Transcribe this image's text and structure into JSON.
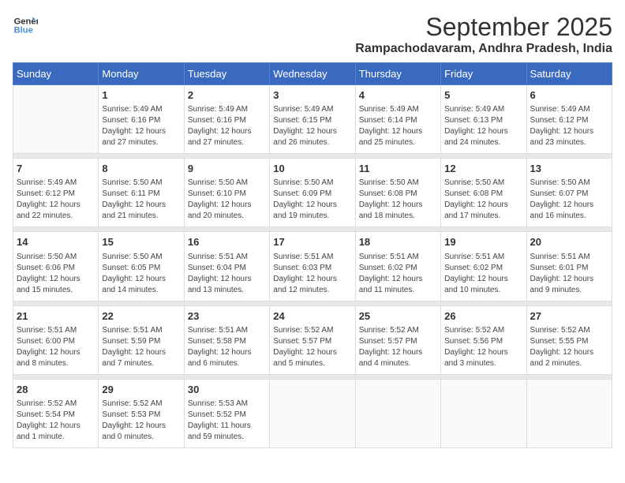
{
  "logo": {
    "line1": "General",
    "line2": "Blue"
  },
  "title": "September 2025",
  "location": "Rampachodavaram, Andhra Pradesh, India",
  "days_of_week": [
    "Sunday",
    "Monday",
    "Tuesday",
    "Wednesday",
    "Thursday",
    "Friday",
    "Saturday"
  ],
  "weeks": [
    [
      {
        "day": "",
        "info": ""
      },
      {
        "day": "1",
        "info": "Sunrise: 5:49 AM\nSunset: 6:16 PM\nDaylight: 12 hours\nand 27 minutes."
      },
      {
        "day": "2",
        "info": "Sunrise: 5:49 AM\nSunset: 6:16 PM\nDaylight: 12 hours\nand 27 minutes."
      },
      {
        "day": "3",
        "info": "Sunrise: 5:49 AM\nSunset: 6:15 PM\nDaylight: 12 hours\nand 26 minutes."
      },
      {
        "day": "4",
        "info": "Sunrise: 5:49 AM\nSunset: 6:14 PM\nDaylight: 12 hours\nand 25 minutes."
      },
      {
        "day": "5",
        "info": "Sunrise: 5:49 AM\nSunset: 6:13 PM\nDaylight: 12 hours\nand 24 minutes."
      },
      {
        "day": "6",
        "info": "Sunrise: 5:49 AM\nSunset: 6:12 PM\nDaylight: 12 hours\nand 23 minutes."
      }
    ],
    [
      {
        "day": "7",
        "info": "Sunrise: 5:49 AM\nSunset: 6:12 PM\nDaylight: 12 hours\nand 22 minutes."
      },
      {
        "day": "8",
        "info": "Sunrise: 5:50 AM\nSunset: 6:11 PM\nDaylight: 12 hours\nand 21 minutes."
      },
      {
        "day": "9",
        "info": "Sunrise: 5:50 AM\nSunset: 6:10 PM\nDaylight: 12 hours\nand 20 minutes."
      },
      {
        "day": "10",
        "info": "Sunrise: 5:50 AM\nSunset: 6:09 PM\nDaylight: 12 hours\nand 19 minutes."
      },
      {
        "day": "11",
        "info": "Sunrise: 5:50 AM\nSunset: 6:08 PM\nDaylight: 12 hours\nand 18 minutes."
      },
      {
        "day": "12",
        "info": "Sunrise: 5:50 AM\nSunset: 6:08 PM\nDaylight: 12 hours\nand 17 minutes."
      },
      {
        "day": "13",
        "info": "Sunrise: 5:50 AM\nSunset: 6:07 PM\nDaylight: 12 hours\nand 16 minutes."
      }
    ],
    [
      {
        "day": "14",
        "info": "Sunrise: 5:50 AM\nSunset: 6:06 PM\nDaylight: 12 hours\nand 15 minutes."
      },
      {
        "day": "15",
        "info": "Sunrise: 5:50 AM\nSunset: 6:05 PM\nDaylight: 12 hours\nand 14 minutes."
      },
      {
        "day": "16",
        "info": "Sunrise: 5:51 AM\nSunset: 6:04 PM\nDaylight: 12 hours\nand 13 minutes."
      },
      {
        "day": "17",
        "info": "Sunrise: 5:51 AM\nSunset: 6:03 PM\nDaylight: 12 hours\nand 12 minutes."
      },
      {
        "day": "18",
        "info": "Sunrise: 5:51 AM\nSunset: 6:02 PM\nDaylight: 12 hours\nand 11 minutes."
      },
      {
        "day": "19",
        "info": "Sunrise: 5:51 AM\nSunset: 6:02 PM\nDaylight: 12 hours\nand 10 minutes."
      },
      {
        "day": "20",
        "info": "Sunrise: 5:51 AM\nSunset: 6:01 PM\nDaylight: 12 hours\nand 9 minutes."
      }
    ],
    [
      {
        "day": "21",
        "info": "Sunrise: 5:51 AM\nSunset: 6:00 PM\nDaylight: 12 hours\nand 8 minutes."
      },
      {
        "day": "22",
        "info": "Sunrise: 5:51 AM\nSunset: 5:59 PM\nDaylight: 12 hours\nand 7 minutes."
      },
      {
        "day": "23",
        "info": "Sunrise: 5:51 AM\nSunset: 5:58 PM\nDaylight: 12 hours\nand 6 minutes."
      },
      {
        "day": "24",
        "info": "Sunrise: 5:52 AM\nSunset: 5:57 PM\nDaylight: 12 hours\nand 5 minutes."
      },
      {
        "day": "25",
        "info": "Sunrise: 5:52 AM\nSunset: 5:57 PM\nDaylight: 12 hours\nand 4 minutes."
      },
      {
        "day": "26",
        "info": "Sunrise: 5:52 AM\nSunset: 5:56 PM\nDaylight: 12 hours\nand 3 minutes."
      },
      {
        "day": "27",
        "info": "Sunrise: 5:52 AM\nSunset: 5:55 PM\nDaylight: 12 hours\nand 2 minutes."
      }
    ],
    [
      {
        "day": "28",
        "info": "Sunrise: 5:52 AM\nSunset: 5:54 PM\nDaylight: 12 hours\nand 1 minute."
      },
      {
        "day": "29",
        "info": "Sunrise: 5:52 AM\nSunset: 5:53 PM\nDaylight: 12 hours\nand 0 minutes."
      },
      {
        "day": "30",
        "info": "Sunrise: 5:53 AM\nSunset: 5:52 PM\nDaylight: 11 hours\nand 59 minutes."
      },
      {
        "day": "",
        "info": ""
      },
      {
        "day": "",
        "info": ""
      },
      {
        "day": "",
        "info": ""
      },
      {
        "day": "",
        "info": ""
      }
    ]
  ]
}
